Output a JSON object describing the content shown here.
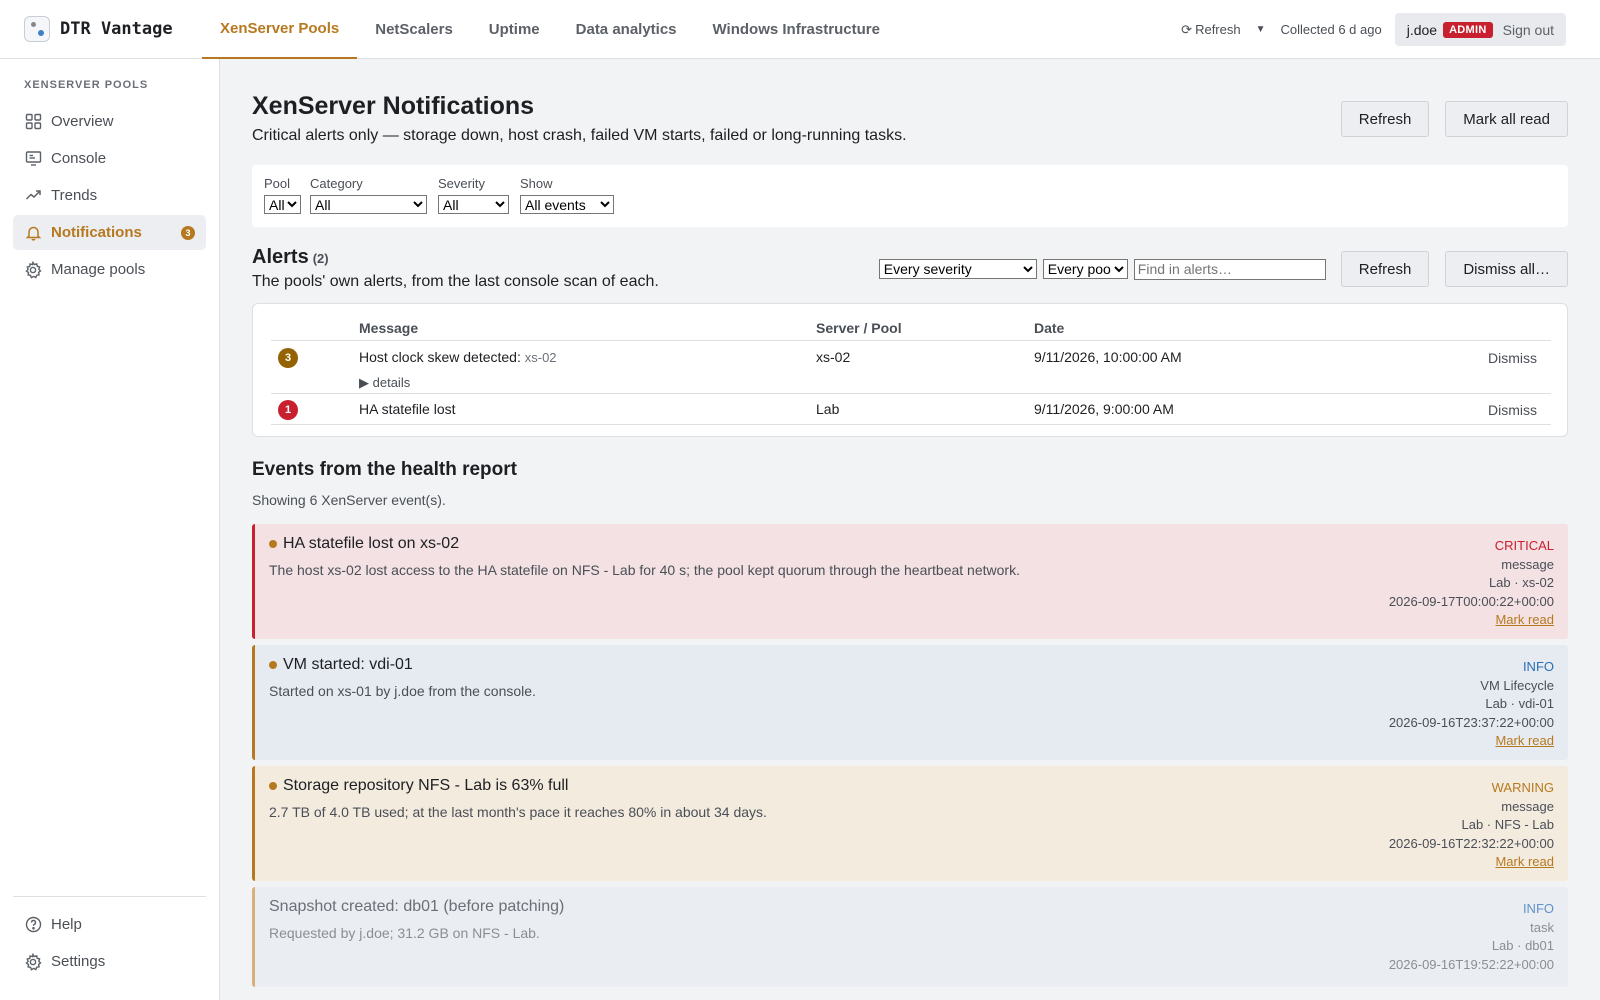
{
  "brand": {
    "name": "DTR Vantage"
  },
  "topnav": {
    "tabs": [
      {
        "label": "XenServer Pools",
        "active": true
      },
      {
        "label": "NetScalers"
      },
      {
        "label": "Uptime"
      },
      {
        "label": "Data analytics"
      },
      {
        "label": "Windows Infrastructure"
      }
    ]
  },
  "topright": {
    "refresh_label": "Refresh",
    "collected": "Collected 6 d ago",
    "user": "j.doe",
    "role_badge": "ADMIN",
    "signout": "Sign out"
  },
  "sidebar": {
    "heading": "XENSERVER POOLS",
    "items": [
      {
        "label": "Overview",
        "icon": "grid-icon"
      },
      {
        "label": "Console",
        "icon": "monitor-icon"
      },
      {
        "label": "Trends",
        "icon": "trend-icon"
      },
      {
        "label": "Notifications",
        "icon": "bell-icon",
        "active": true,
        "count": "3"
      },
      {
        "label": "Manage pools",
        "icon": "gear-icon"
      }
    ],
    "bottom": [
      {
        "label": "Help",
        "icon": "help-icon"
      },
      {
        "label": "Settings",
        "icon": "gear-icon"
      }
    ]
  },
  "page": {
    "title": "XenServer Notifications",
    "subtitle": "Critical alerts only — storage down, host crash, failed VM starts, failed or long-running tasks.",
    "refresh_button": "Refresh",
    "mark_all_read_button": "Mark all read"
  },
  "filters": {
    "pool": {
      "label": "Pool",
      "value": "All"
    },
    "category": {
      "label": "Category",
      "value": "All"
    },
    "severity": {
      "label": "Severity",
      "value": "All"
    },
    "show": {
      "label": "Show",
      "value": "All events"
    }
  },
  "alerts": {
    "title": "Alerts",
    "count": "(2)",
    "subtitle": "The pools' own alerts, from the last console scan of each.",
    "severity_filter": "Every severity",
    "pool_filter": "Every pool",
    "search_placeholder": "Find in alerts…",
    "refresh_button": "Refresh",
    "dismiss_all_button": "Dismiss all…",
    "columns": [
      "",
      "Message",
      "Server / Pool",
      "Date",
      ""
    ],
    "rows": [
      {
        "severity": "3",
        "severity_color": "#946200",
        "message": "Host clock skew detected:",
        "message_host": "xs-02",
        "details": "details",
        "server": "xs-02",
        "date": "9/11/2026, 10:00:00 AM",
        "action": "Dismiss"
      },
      {
        "severity": "1",
        "severity_color": "#c8202f",
        "message": "HA statefile lost",
        "message_host": "",
        "details": "",
        "server": "Lab",
        "date": "9/11/2026, 9:00:00 AM",
        "action": "Dismiss"
      }
    ]
  },
  "events": {
    "title": "Events from the health report",
    "subtitle": "Showing 6 XenServer event(s).",
    "items": [
      {
        "title": "HA statefile lost on xs-02",
        "body": "The host xs-02 lost access to the HA statefile on NFS - Lab for 40 s; the pool kept quorum through the heartbeat network.",
        "severity": "CRITICAL",
        "kind": "message",
        "where": "Lab · xs-02",
        "time": "2026-09-17T00:00:22+00:00",
        "action": "Mark read",
        "style": "critical",
        "unread": true
      },
      {
        "title": "VM started: vdi-01",
        "body": "Started on xs-01 by j.doe from the console.",
        "severity": "INFO",
        "kind": "VM Lifecycle",
        "where": "Lab · vdi-01",
        "time": "2026-09-16T23:37:22+00:00",
        "action": "Mark read",
        "style": "info",
        "unread": true
      },
      {
        "title": "Storage repository NFS - Lab is 63% full",
        "body": "2.7 TB of 4.0 TB used; at the last month's pace it reaches 80% in about 34 days.",
        "severity": "WARNING",
        "kind": "message",
        "where": "Lab · NFS - Lab",
        "time": "2026-09-16T22:32:22+00:00",
        "action": "Mark read",
        "style": "warning",
        "unread": true
      },
      {
        "title": "Snapshot created: db01 (before patching)",
        "body": "Requested by j.doe; 31.2 GB on NFS - Lab.",
        "severity": "INFO",
        "kind": "task",
        "where": "Lab · db01",
        "time": "2026-09-16T19:52:22+00:00",
        "action": "",
        "style": "read",
        "unread": false
      }
    ]
  }
}
